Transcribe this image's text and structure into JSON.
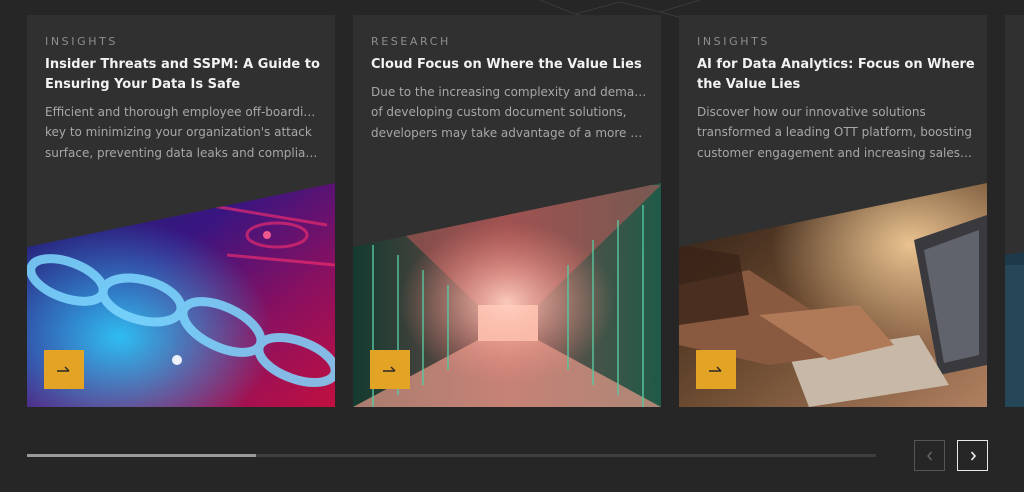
{
  "cards": [
    {
      "category": "INSIGHTS",
      "title": "Insider Threats and SSPM: A Guide to Ensuring Your Data Is Safe",
      "excerpt": [
        "Efficient and thorough employee off-boarding is",
        "key to minimizing your organization's attack",
        "surface, preventing data leaks and compliance..."
      ],
      "image": "chain-link-cybersecurity-image",
      "arrow_icon": "arrow-right-icon"
    },
    {
      "category": "RESEARCH",
      "title": "Cloud Focus on Where the Value Lies",
      "excerpt": [
        "Due to the increasing complexity and demands",
        "of developing custom document solutions,",
        "developers may take advantage of a more pow..."
      ],
      "image": "server-room-corridor-image",
      "arrow_icon": "arrow-right-icon"
    },
    {
      "category": "INSIGHTS",
      "title": "AI for Data Analytics: Focus on Where the Value Lies",
      "excerpt": [
        "Discover how our innovative solutions",
        "transformed a leading OTT platform, boosting",
        "customer engagement and increasing sales by..."
      ],
      "image": "hands-typing-laptop-image",
      "arrow_icon": "arrow-right-icon"
    }
  ],
  "carousel": {
    "progress_percent": 27,
    "prev_icon": "chevron-left-icon",
    "next_icon": "chevron-right-icon",
    "prev_enabled": false,
    "next_enabled": true
  },
  "colors": {
    "background": "#262626",
    "card": "#303030",
    "accent": "#e3a325",
    "title": "#f2f2f2",
    "text": "#a7a7a7"
  }
}
